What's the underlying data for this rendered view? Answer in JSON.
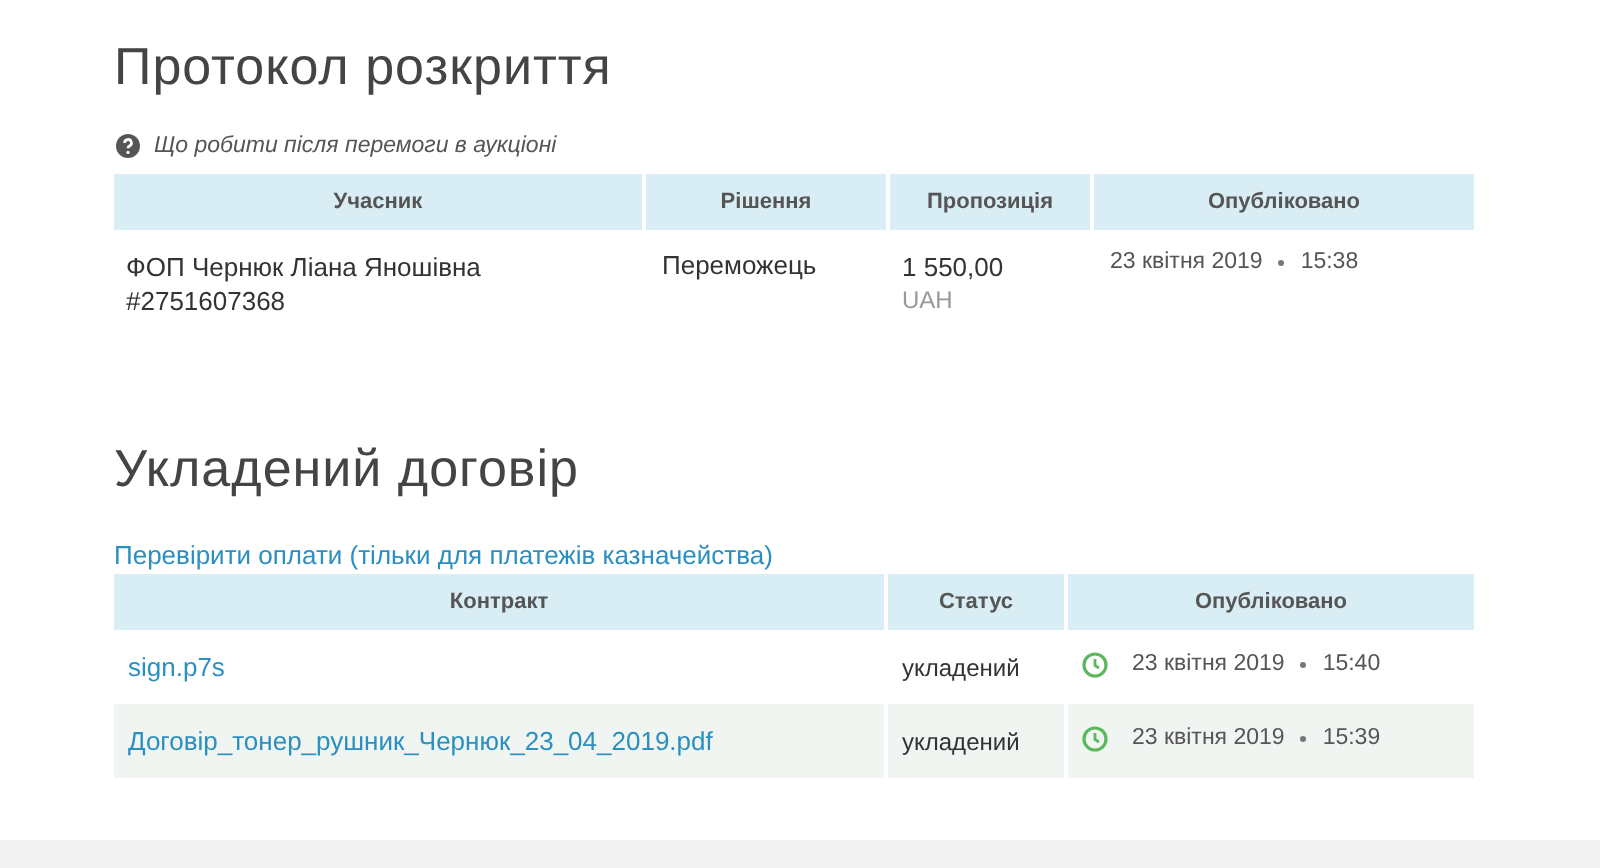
{
  "protocol": {
    "title": "Протокол розкриття",
    "help_link": "Що робити після перемоги в аукціоні",
    "columns": [
      "Учасник",
      "Рішення",
      "Пропозиція",
      "Опубліковано"
    ],
    "rows": [
      {
        "participant": "ФОП Чернюк Ліана Яношівна",
        "participant_id": "#2751607368",
        "decision": "Переможець",
        "amount": "1 550,00",
        "currency": "UAH",
        "date": "23 квітня 2019",
        "time": "15:38"
      }
    ]
  },
  "contract": {
    "title": "Укладений договір",
    "payments_link": "Перевірити оплати (тільки для платежів казначейства)",
    "columns": [
      "Контракт",
      "Статус",
      "Опубліковано"
    ],
    "rows": [
      {
        "file": "sign.p7s",
        "status": "укладений",
        "date": "23 квітня 2019",
        "time": "15:40"
      },
      {
        "file": "Договір_тонер_рушник_Чернюк_23_04_2019.pdf",
        "status": "укладений",
        "date": "23 квітня 2019",
        "time": "15:39"
      }
    ]
  }
}
